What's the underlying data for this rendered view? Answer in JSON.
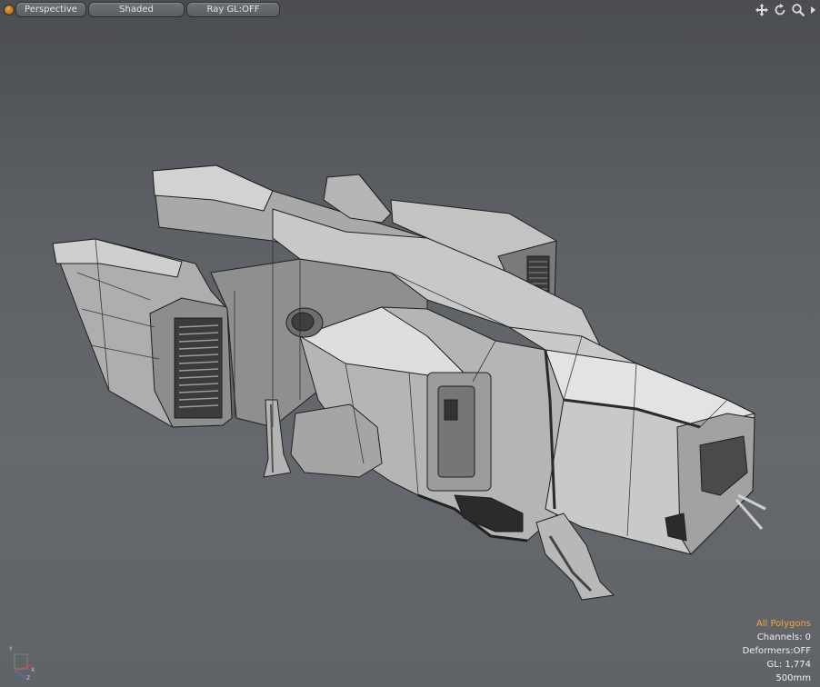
{
  "toolbar": {
    "view_mode": "Perspective",
    "shading_mode": "Shaded",
    "raygl": "Ray GL:OFF"
  },
  "nav_icons": [
    "move-view-icon",
    "rotate-view-icon",
    "zoom-view-icon",
    "expand-arrow-icon"
  ],
  "info": {
    "selection": "All Polygons",
    "channels": "Channels: 0",
    "deformers": "Deformers:OFF",
    "gl": "GL: 1,774",
    "scale": "500mm"
  },
  "axis_gizmo": {
    "labels": [
      "Y",
      "X",
      "Z"
    ]
  },
  "colors": {
    "background_top": "#4b4d52",
    "background_bottom": "#606367",
    "highlight": "#f3a53a",
    "mesh_light": "#c9c9c9",
    "mesh_mid": "#9a9a9a",
    "mesh_dark": "#3e3e3e"
  }
}
